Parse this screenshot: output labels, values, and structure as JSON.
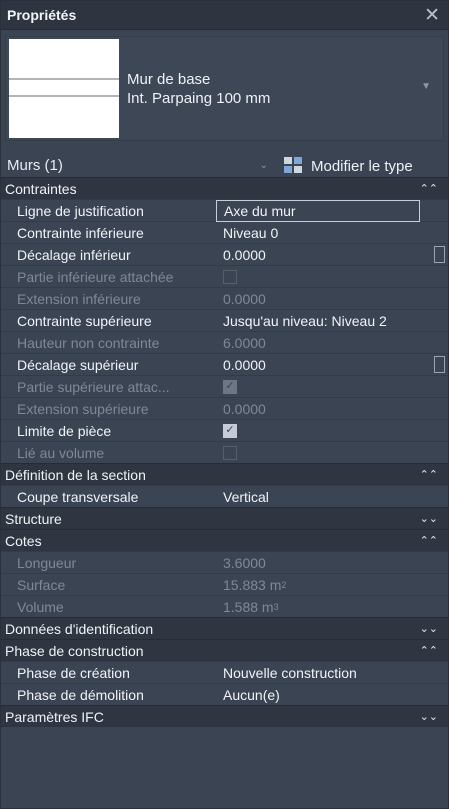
{
  "window": {
    "title": "Propriétés"
  },
  "type_selector": {
    "line1": "Mur de base",
    "line2": "Int. Parpaing 100 mm"
  },
  "filter": {
    "value": "Murs (1)"
  },
  "edit_type": {
    "label": "Modifier le type"
  },
  "groups": {
    "contraintes": "Contraintes",
    "definition": "Définition de la section",
    "structure": "Structure",
    "cotes": "Cotes",
    "identification": "Données d'identification",
    "phase": "Phase de construction",
    "ifc": "Paramètres IFC"
  },
  "contraintes": {
    "r1": {
      "label": "Ligne de justification",
      "value": "Axe du mur"
    },
    "r2": {
      "label": "Contrainte inférieure",
      "value": "Niveau 0"
    },
    "r3": {
      "label": "Décalage inférieur",
      "value": "0.0000"
    },
    "r4": {
      "label": "Partie inférieure attachée",
      "checked": false
    },
    "r5": {
      "label": "Extension inférieure",
      "value": "0.0000"
    },
    "r6": {
      "label": "Contrainte supérieure",
      "value": "Jusqu'au niveau: Niveau 2"
    },
    "r7": {
      "label": "Hauteur non contrainte",
      "value": "6.0000"
    },
    "r8": {
      "label": "Décalage supérieur",
      "value": "0.0000"
    },
    "r9": {
      "label": "Partie supérieure attac...",
      "checked": true
    },
    "r10": {
      "label": "Extension supérieure",
      "value": "0.0000"
    },
    "r11": {
      "label": "Limite de pièce",
      "checked": true
    },
    "r12": {
      "label": "Lié au volume",
      "checked": false
    }
  },
  "definition": {
    "r1": {
      "label": "Coupe transversale",
      "value": "Vertical"
    }
  },
  "cotes": {
    "r1": {
      "label": "Longueur",
      "value": "3.6000"
    },
    "r2": {
      "label": "Surface",
      "value": "15.883 m",
      "unit_exp": "2"
    },
    "r3": {
      "label": "Volume",
      "value": "1.588 m",
      "unit_exp": "3"
    }
  },
  "phase": {
    "r1": {
      "label": "Phase de création",
      "value": "Nouvelle construction"
    },
    "r2": {
      "label": "Phase de démolition",
      "value": "Aucun(e)"
    }
  },
  "icons": {
    "collapse": "⌃⌃",
    "expand": "⌄⌄",
    "check": "✓"
  }
}
